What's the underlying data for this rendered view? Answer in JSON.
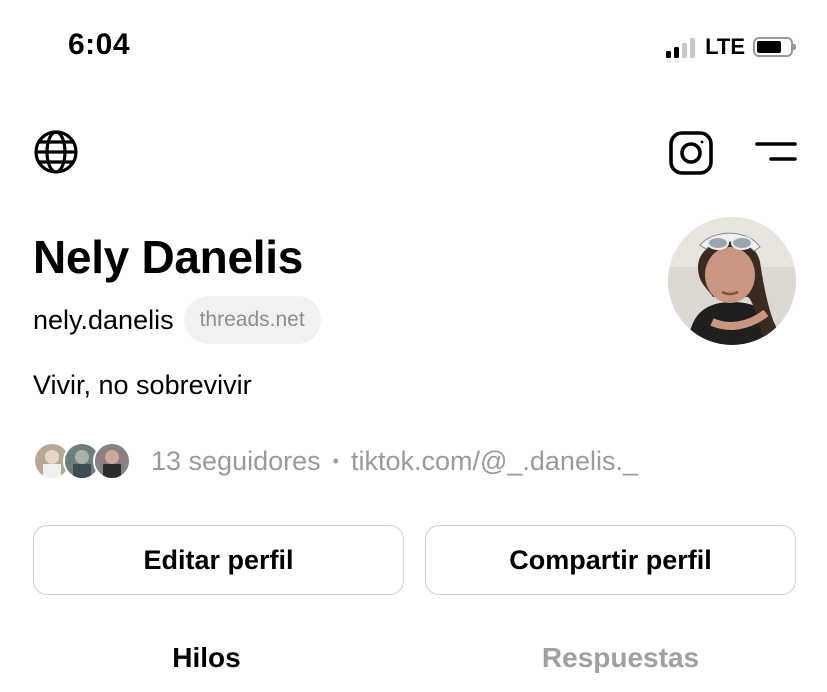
{
  "status_bar": {
    "time": "6:04",
    "network": "LTE"
  },
  "header": {
    "left_icon": "globe-icon",
    "right_icons": [
      "instagram-icon",
      "menu-icon"
    ]
  },
  "profile": {
    "name": "Nely Danelis",
    "handle": "nely.danelis",
    "domain_badge": "threads.net",
    "bio": "Vivir, no sobrevivir",
    "followers": "13 seguidores",
    "separator": "•",
    "link": "tiktok.com/@_.danelis._"
  },
  "buttons": {
    "edit": "Editar perfil",
    "share": "Compartir perfil"
  },
  "tabs": [
    {
      "label": "Hilos",
      "active": true
    },
    {
      "label": "Respuestas",
      "active": false
    }
  ],
  "colors": {
    "text": "#000000",
    "muted": "#9a9a9a",
    "border": "#d0d0d0",
    "badge_bg": "#f1f1f1"
  }
}
